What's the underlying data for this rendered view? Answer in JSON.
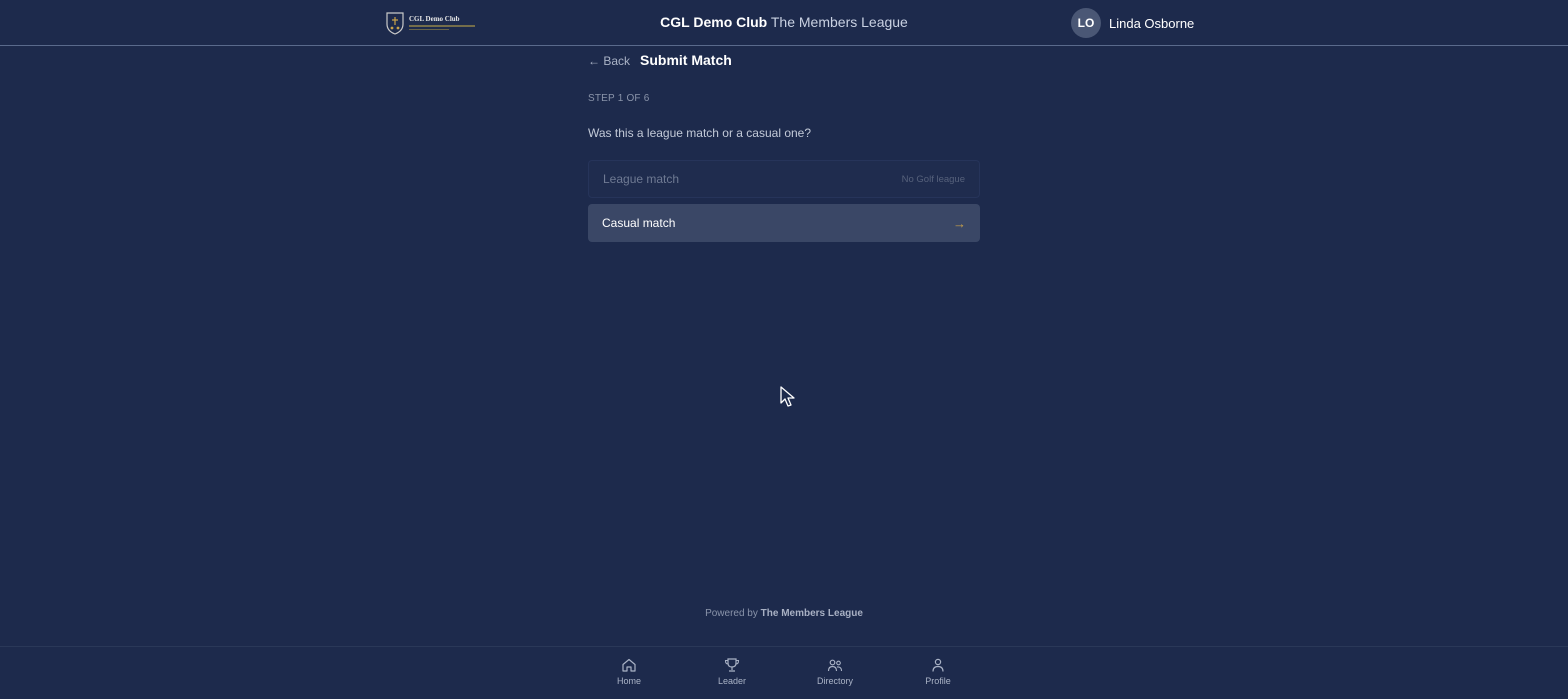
{
  "header": {
    "logo_text": "CGL Demo Club",
    "club_name": "CGL Demo Club",
    "league_name": "The Members League",
    "user": {
      "initials": "LO",
      "name": "Linda Osborne"
    }
  },
  "page": {
    "back_label": "← Back",
    "title": "Submit Match",
    "step": "STEP 1 OF 6",
    "question": "Was this a league match or a casual one?",
    "options": [
      {
        "label": "League match",
        "note": "No Golf league",
        "disabled": true
      },
      {
        "label": "Casual match",
        "arrow": "→",
        "disabled": false
      }
    ]
  },
  "footer": {
    "powered_prefix": "Powered by",
    "powered_name": "The Members League"
  },
  "bottom_nav": {
    "items": [
      {
        "label": "Home",
        "icon": "home-icon"
      },
      {
        "label": "Leader",
        "icon": "trophy-icon"
      },
      {
        "label": "Directory",
        "icon": "people-icon"
      },
      {
        "label": "Profile",
        "icon": "person-icon"
      }
    ]
  },
  "colors": {
    "background": "#1d2a4c",
    "selected_option": "#3a4766",
    "accent_arrow": "#c9a24a"
  }
}
